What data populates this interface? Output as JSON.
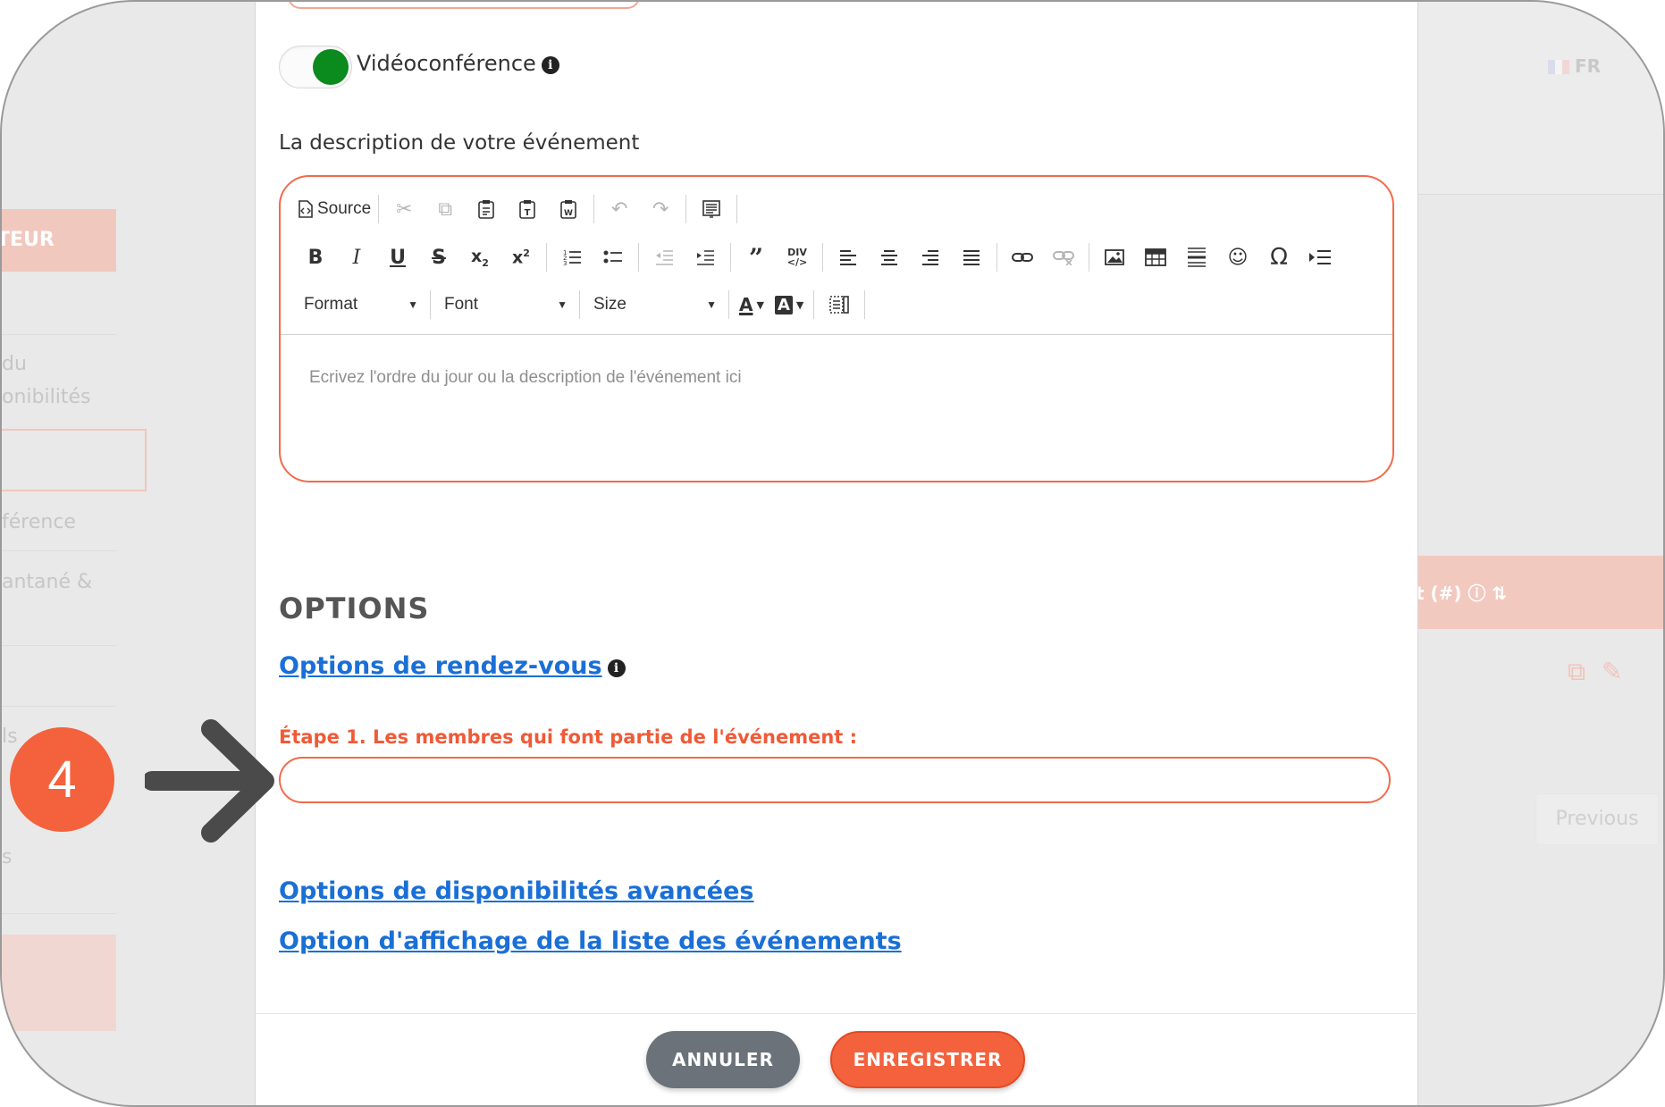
{
  "background": {
    "sidebar_header": "TEUR",
    "sidebar_texts": [
      "du",
      "onibilités",
      "férence",
      "antané &",
      "ls",
      "s"
    ],
    "language": "FR",
    "table_header": "t (#)",
    "previous_button": "Previous"
  },
  "modal": {
    "videoconference_toggle": {
      "label": "Vidéoconférence",
      "checked": true,
      "color": "#0b8a1e"
    },
    "description_label": "La description de votre événement",
    "editor": {
      "row1": {
        "source_label": "Source"
      },
      "row3": {
        "format_label": "Format",
        "font_label": "Font",
        "size_label": "Size"
      },
      "placeholder": "Ecrivez l'ordre du jour ou la description de l'événement ici"
    },
    "options": {
      "title": "OPTIONS",
      "appointment_link": "Options de rendez-vous",
      "step_label": "Étape 1. Les membres qui font partie de l'événement :",
      "members_input_value": "",
      "advanced_availability_link": "Options de disponibilités avancées",
      "event_list_display_link": "Option d'affichage de la liste des événements"
    },
    "footer": {
      "cancel_label": "ANNULER",
      "save_label": "ENREGISTRER"
    }
  },
  "annotation": {
    "step_number": "4",
    "accent_color": "#f4623d",
    "arrow_color": "#4a4a4a"
  },
  "colors": {
    "accent": "#f26a4b",
    "link": "#1a6fd6",
    "cancel": "#6b7279"
  }
}
